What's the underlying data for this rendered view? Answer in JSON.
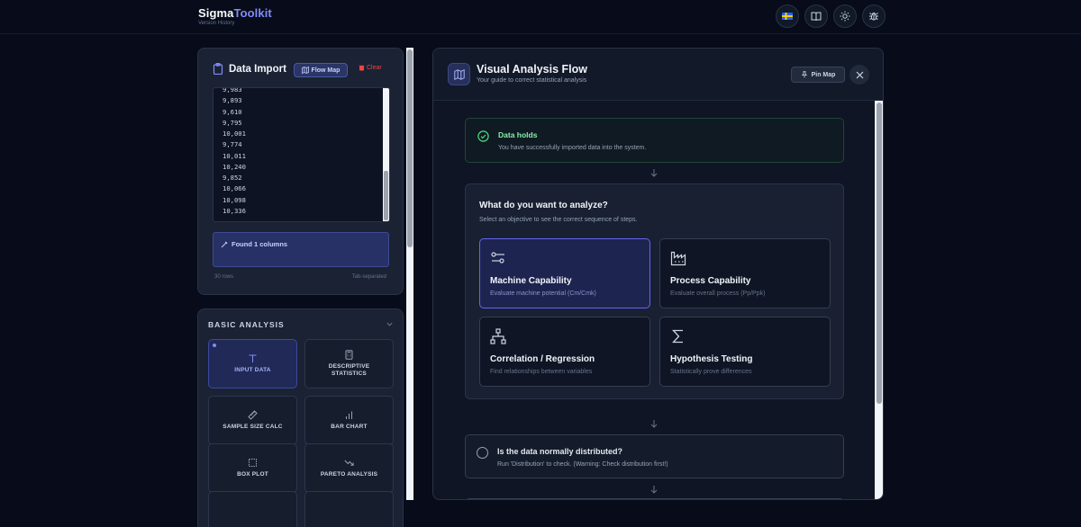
{
  "header": {
    "brand_main": "Sigma",
    "brand_accent": "Toolkit",
    "subtitle": "Version History",
    "icons": [
      "flag-icon",
      "book-icon",
      "sun-icon",
      "bug-icon"
    ]
  },
  "import_panel": {
    "title": "Data Import",
    "flow_map_label": "Flow Map",
    "clear_label": "Clear",
    "data_values": [
      "9,983",
      "9,893",
      "9,610",
      "9,795",
      "10,001",
      "9,774",
      "10,011",
      "10,240",
      "9,852",
      "10,066",
      "10,098",
      "10,336"
    ],
    "found_text": "Found 1 columns",
    "rows_text": "30 rows",
    "separator_text": "Tab-separated"
  },
  "basic_analysis": {
    "title": "BASIC ANALYSIS",
    "tiles": [
      {
        "label": "INPUT DATA",
        "icon": "text-icon",
        "active": true
      },
      {
        "label": "DESCRIPTIVE STATISTICS",
        "icon": "calculator-icon",
        "active": false
      },
      {
        "label": "SAMPLE SIZE CALC",
        "icon": "ruler-icon",
        "active": false
      },
      {
        "label": "BAR CHART",
        "icon": "bar-chart-icon",
        "active": false
      },
      {
        "label": "BOX PLOT",
        "icon": "box-plot-icon",
        "active": false
      },
      {
        "label": "PARETO ANALYSIS",
        "icon": "trend-down-icon",
        "active": false
      }
    ]
  },
  "flow": {
    "title": "Visual Analysis Flow",
    "subtitle": "Your guide to correct statistical analysis",
    "pin_label": "Pin Map",
    "step1": {
      "title": "Data holds",
      "desc": "You have successfully imported data into the system."
    },
    "analyze": {
      "title": "What do you want to analyze?",
      "subtitle": "Select an objective to see the correct sequence of steps.",
      "options": [
        {
          "title": "Machine Capability",
          "desc": "Evaluate machine potential (Cm/Cmk)",
          "selected": true
        },
        {
          "title": "Process Capability",
          "desc": "Evaluate overall process (Pp/Ppk)",
          "selected": false
        },
        {
          "title": "Correlation / Regression",
          "desc": "Find relationships between variables",
          "selected": false
        },
        {
          "title": "Hypothesis Testing",
          "desc": "Statistically prove differences",
          "selected": false
        }
      ]
    },
    "step3": {
      "title": "Is the data normally distributed?",
      "desc": "Run 'Distribution' to check. (Warning: Check distribution first!)"
    }
  }
}
